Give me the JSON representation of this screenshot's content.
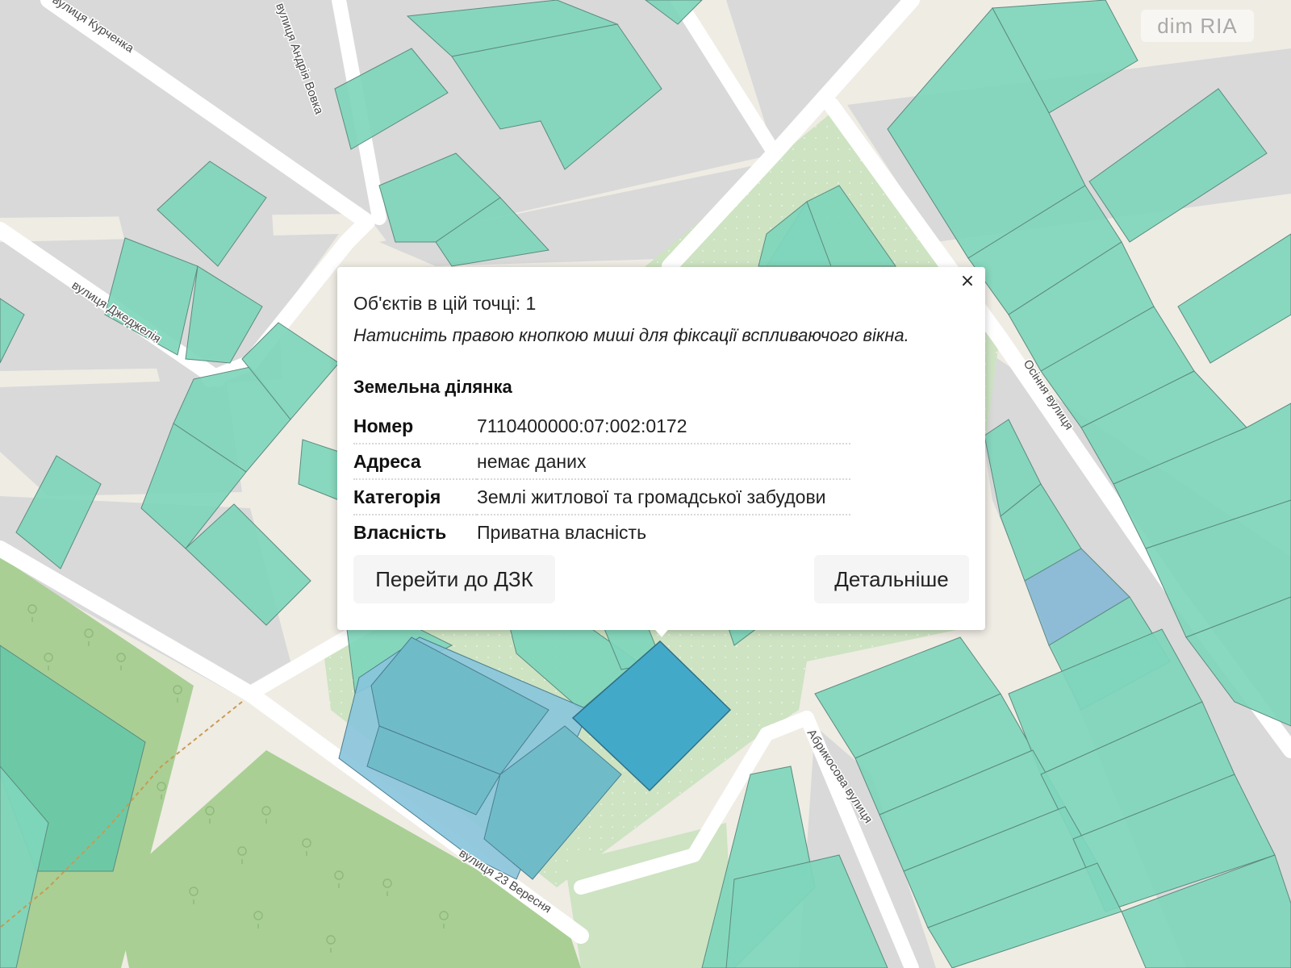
{
  "map": {
    "streets": [
      "вулиця Курченка",
      "вулиця Андрія Вовка",
      "вулиця Джеджелія",
      "Осіння вулиця",
      "Абрикосова вулиця",
      "вулиця 23 Вересня"
    ],
    "colors": {
      "background": "#efece4",
      "block": "#d9d9d9",
      "road": "#ffffff",
      "parcel": "#7fd6bc",
      "park": "#a9cf95",
      "selected_parcel": "#43a9c9",
      "communal_parcel": "#88b8d6"
    },
    "watermark": "dim RIA"
  },
  "popup": {
    "count_text": "Об'єктів в цій точці: 1",
    "hint_text": "Натисніть правою кнопкою миші для фіксації вспливаючого вікна.",
    "section_title": "Земельна ділянка",
    "attributes": [
      {
        "key": "Номер",
        "value": "7110400000:07:002:0172"
      },
      {
        "key": "Адреса",
        "value": "немає даних"
      },
      {
        "key": "Категорія",
        "value": "Землі житлової та громадської забудови"
      },
      {
        "key": "Власність",
        "value": "Приватна власність"
      }
    ],
    "close_label": "×",
    "buttons": {
      "dzk_label": "Перейти до ДЗК",
      "details_label": "Детальніше"
    }
  }
}
